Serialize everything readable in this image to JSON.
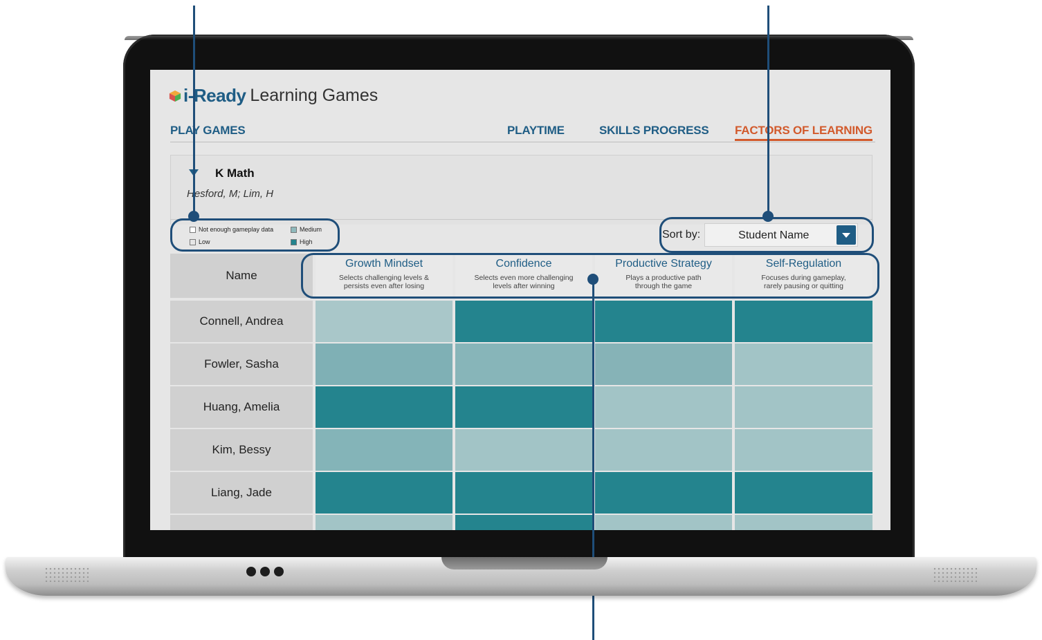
{
  "app": {
    "brand": "i-Ready",
    "product": "Learning Games"
  },
  "nav": {
    "play_games": "PLAY GAMES",
    "playtime": "PLAYTIME",
    "skills_progress": "SKILLS PROGRESS",
    "factors_of_learning": "FACTORS OF LEARNING",
    "active": "FACTORS OF LEARNING",
    "active_color": "#d25a2c",
    "link_color": "#1f5d85"
  },
  "class_panel": {
    "title": "K Math",
    "teachers": "Hesford, M;  Lim, H"
  },
  "legend": {
    "not_enough": "Not enough gameplay data",
    "low": "Low",
    "medium": "Medium",
    "high": "High",
    "colors": {
      "not_enough": "#ffffff",
      "low": "#e6e6e6",
      "medium": "#8fb9bc",
      "high": "#24848e"
    }
  },
  "sort": {
    "label": "Sort by:",
    "value": "Student Name"
  },
  "table": {
    "name_header": "Name",
    "columns": [
      {
        "title": "Growth Mindset",
        "desc": "Selects challenging levels &\npersists even after losing"
      },
      {
        "title": "Confidence",
        "desc": "Selects even more challenging\nlevels after winning"
      },
      {
        "title": "Productive Strategy",
        "desc": "Plays a productive path\nthrough the game"
      },
      {
        "title": "Self-Regulation",
        "desc": "Focuses during gameplay,\nrarely pausing or quitting"
      }
    ],
    "rows": [
      {
        "name": "Connell, Andrea",
        "cells": [
          "#a9c7c9",
          "#24848e",
          "#24848e",
          "#24848e"
        ]
      },
      {
        "name": "Fowler, Sasha",
        "cells": [
          "#7fb0b5",
          "#87b5b9",
          "#86b3b7",
          "#a2c4c6"
        ]
      },
      {
        "name": "Huang, Amelia",
        "cells": [
          "#24848e",
          "#24848e",
          "#a2c4c6",
          "#a2c4c6"
        ]
      },
      {
        "name": "Kim, Bessy",
        "cells": [
          "#84b4b8",
          "#a2c4c6",
          "#a2c4c6",
          "#a2c4c6"
        ]
      },
      {
        "name": "Liang, Jade",
        "cells": [
          "#24848e",
          "#24848e",
          "#24848e",
          "#24848e"
        ]
      },
      {
        "name": "",
        "cells": [
          "#a2c4c6",
          "#24848e",
          "#a2c4c6",
          "#a2c4c6"
        ]
      }
    ]
  }
}
